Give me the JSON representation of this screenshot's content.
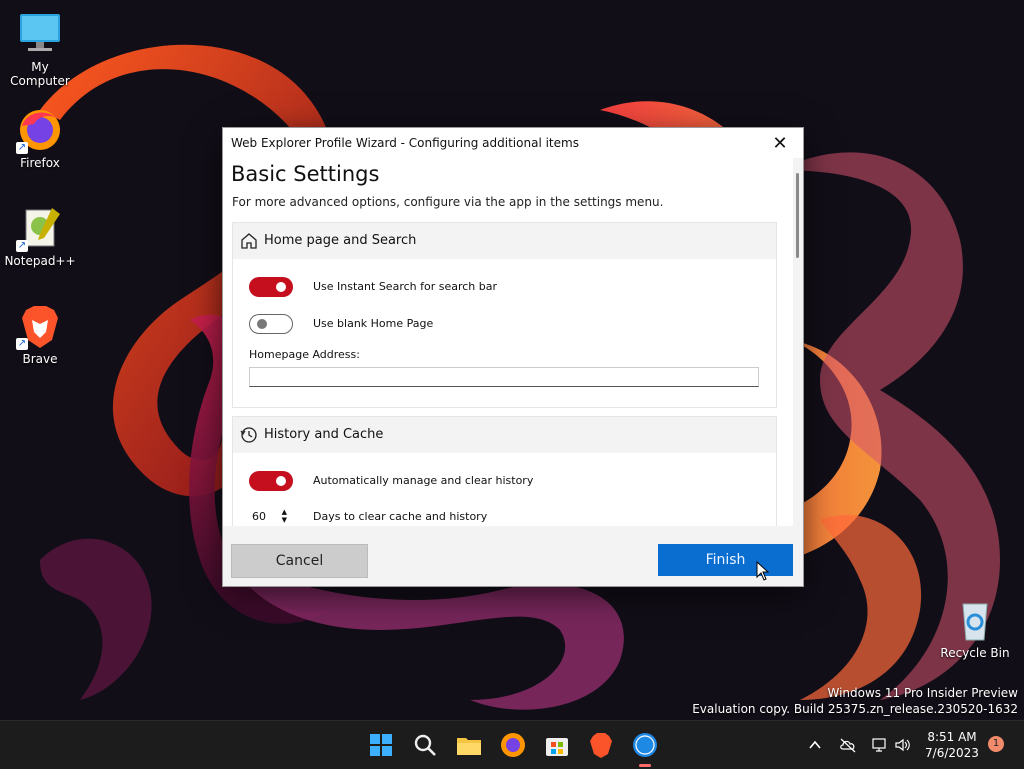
{
  "desktop": {
    "icons": [
      {
        "label": "My Computer"
      },
      {
        "label": "Firefox"
      },
      {
        "label": "Notepad++"
      },
      {
        "label": "Brave"
      },
      {
        "label": "Recycle Bin"
      }
    ],
    "watermark": {
      "line1": "Windows 11 Pro Insider Preview",
      "line2": "Evaluation copy. Build 25375.zn_release.230520-1632"
    }
  },
  "dialog": {
    "title": "Web Explorer Profile Wizard - Configuring additional items",
    "close_glyph": "✕",
    "heading": "Basic Settings",
    "subheading": "For more advanced options, configure via the app in the settings menu.",
    "sections": [
      {
        "title": "Home page and Search",
        "icon": "home-icon",
        "toggles": [
          {
            "label": "Use Instant Search for search bar",
            "on": true
          },
          {
            "label": "Use blank Home Page",
            "on": false
          }
        ],
        "field": {
          "label": "Homepage Address:",
          "value": ""
        }
      },
      {
        "title": "History and Cache",
        "icon": "history-icon",
        "toggles": [
          {
            "label": "Automatically manage and clear history",
            "on": true
          }
        ],
        "stepper": {
          "value": "60",
          "label": "Days to clear cache and history"
        }
      }
    ],
    "buttons": {
      "cancel": "Cancel",
      "finish": "Finish"
    },
    "colors": {
      "toggle_on": "#c50f1f",
      "primary": "#0a6ed1"
    }
  },
  "taskbar": {
    "icons": [
      "windows-start-icon",
      "search-icon",
      "file-explorer-icon",
      "firefox-icon",
      "store-icon",
      "brave-icon",
      "web-explorer-icon"
    ],
    "clock": {
      "time": "8:51 AM",
      "date": "7/6/2023"
    },
    "notification_count": "1"
  }
}
